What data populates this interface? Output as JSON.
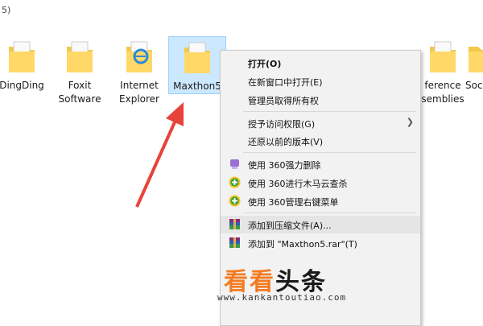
{
  "address": {
    "text": "5)"
  },
  "files": [
    {
      "label": "DingDing",
      "icon": "folder-icon"
    },
    {
      "label": "Foxit Software",
      "icon": "folder-icon"
    },
    {
      "label": "Internet Explorer",
      "icon": "ie-folder-icon"
    },
    {
      "label": "Maxthon5",
      "icon": "folder-icon",
      "selected": true
    },
    {
      "label": "ference semblies",
      "icon": "folder-icon"
    },
    {
      "label": "Soc",
      "icon": "folder-icon"
    }
  ],
  "menu": {
    "items": [
      {
        "label": "打开(O)",
        "bold": true
      },
      {
        "label": "在新窗口中打开(E)"
      },
      {
        "label": "管理员取得所有权"
      },
      {
        "label": "授予访问权限(G)",
        "submenu": true
      },
      {
        "label": "还原以前的版本(V)"
      },
      {
        "label": "使用 360强力删除",
        "icon": "shredder-360-icon"
      },
      {
        "label": "使用 360进行木马云查杀",
        "icon": "shield-360-icon"
      },
      {
        "label": "使用 360管理右键菜单",
        "icon": "shield-360-icon"
      },
      {
        "label": "添加到压缩文件(A)...",
        "icon": "winrar-icon",
        "highlighted": true
      },
      {
        "label": "添加到 \"Maxthon5.rar\"(T)",
        "icon": "winrar-icon"
      }
    ]
  },
  "watermark": {
    "part_a": "看看",
    "part_b": "头条",
    "url": "www.kankantoutiao.com"
  },
  "colors": {
    "selection": "#cce8ff",
    "menu_bg": "#f2f2f2",
    "arrow": "#e8433a",
    "brand": "#f47a20"
  }
}
